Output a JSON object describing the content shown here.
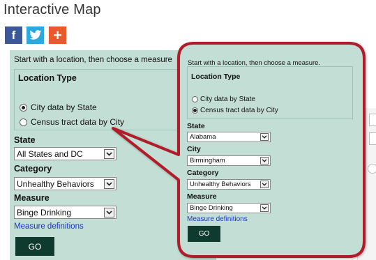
{
  "page": {
    "title": "Interactive Map"
  },
  "social": {
    "facebook_glyph": "f",
    "plus_glyph": "+"
  },
  "back_panel": {
    "intro": "Start with a location, then choose a measure",
    "location_type_label": "Location Type",
    "radio_city": "City data by State",
    "radio_census": "Census tract data by City",
    "state_label": "State",
    "state_value": "All States and DC",
    "category_label": "Category",
    "category_value": "Unhealthy Behaviors",
    "measure_label": "Measure",
    "measure_value": "Binge Drinking",
    "definitions_link": "Measure definitions",
    "go_button": "GO"
  },
  "zoom_panel": {
    "intro": "Start with a location, then choose a measure.",
    "location_type_label": "Location Type",
    "radio_city": "City data by State",
    "radio_census": "Census tract data by City",
    "state_label": "State",
    "state_value": "Alabama",
    "city_label": "City",
    "city_value": "Birmingham",
    "category_label": "Category",
    "category_value": "Unhealthy Behaviors",
    "measure_label": "Measure",
    "measure_value": "Binge Drinking",
    "definitions_link": "Measure definitions",
    "go_button": "GO"
  },
  "state": {
    "back_selected_location": "City data by State",
    "zoom_selected_location": "Census tract data by City"
  },
  "colors": {
    "panel_bg": "#c3dfd5",
    "go_button_bg": "#0f3a2e",
    "callout_border": "#b11c2a",
    "link": "#1a35c8",
    "facebook": "#3b5998",
    "twitter": "#2aa9e0",
    "share_plus": "#e8592e"
  },
  "icons": {
    "facebook": "facebook-icon",
    "twitter": "twitter-icon",
    "share": "plus-share-icon",
    "dropdown": "chevron-down-icon"
  }
}
